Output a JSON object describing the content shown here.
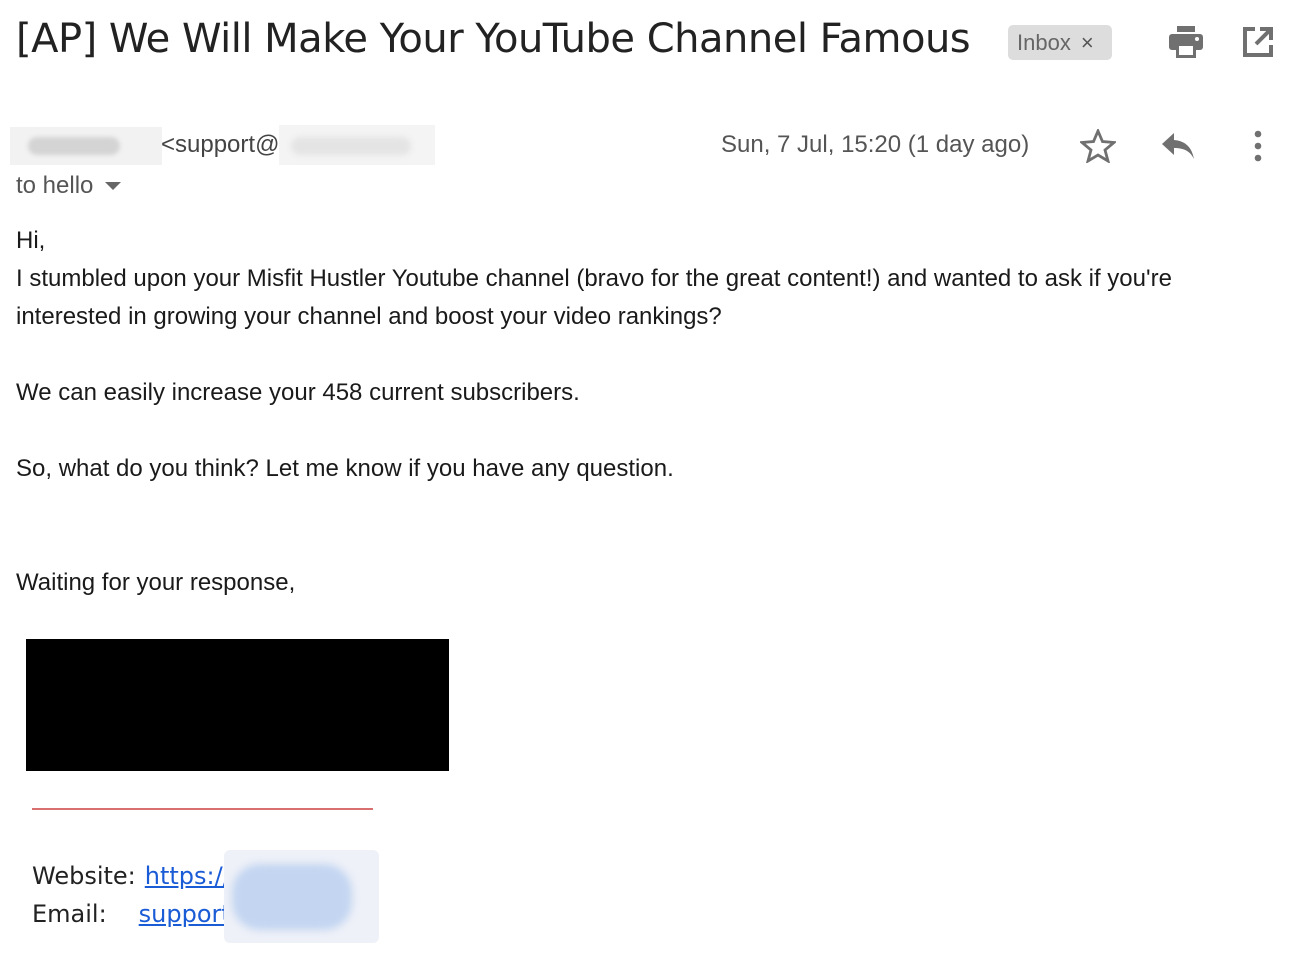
{
  "header": {
    "subject": "[AP] We Will Make Your YouTube Channel Famous",
    "label": "Inbox",
    "label_remove": "×",
    "icons": [
      "print-icon",
      "open-in-new-window-icon"
    ]
  },
  "message": {
    "sender_email_prefix": "<support@",
    "recipient": "to hello",
    "date": "Sun, 7 Jul, 15:20 (1 day ago)",
    "actions": [
      "star-icon",
      "reply-icon",
      "more-options-icon"
    ]
  },
  "body": {
    "greeting": "Hi,",
    "para1_line1": "I stumbled upon your Misfit Hustler Youtube channel (bravo for the great content!) and wanted to ask if you're",
    "para1_line2": "interested in growing your channel and boost your video rankings?",
    "para2": "We can easily increase your 458 current subscribers.",
    "para3": "So, what do you think? Let me know if you have any question.",
    "closing": "Waiting for your response,"
  },
  "signature": {
    "website_label": "Website:",
    "website_link": "https://",
    "email_label": "Email:",
    "email_link": "support"
  }
}
